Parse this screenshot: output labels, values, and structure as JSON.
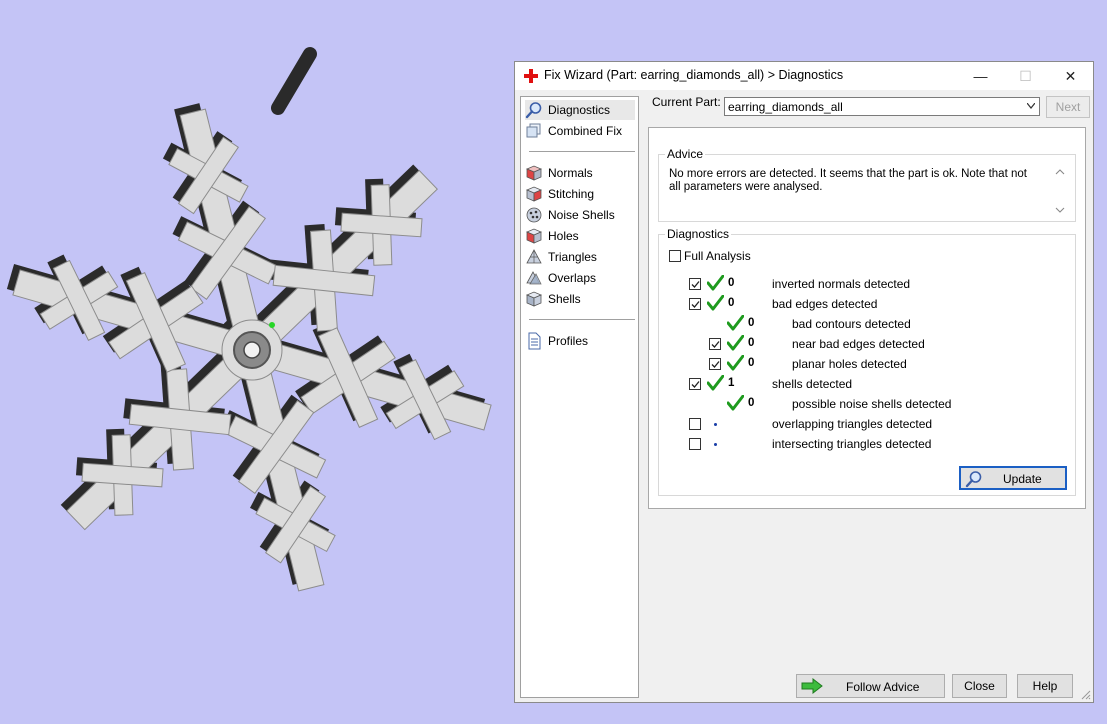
{
  "window": {
    "title": "Fix Wizard (Part: earring_diamonds_all) > Diagnostics",
    "controls": {
      "minimize": "—",
      "maximize": "☐",
      "close": "✕"
    }
  },
  "nav": {
    "items": [
      {
        "label": "Diagnostics",
        "icon": "magnifier-icon",
        "active": true
      },
      {
        "label": "Combined Fix",
        "icon": "combined-fix-icon"
      },
      {
        "label": "Normals",
        "icon": "normals-cube-icon"
      },
      {
        "label": "Stitching",
        "icon": "stitching-cube-icon"
      },
      {
        "label": "Noise Shells",
        "icon": "noise-shells-icon"
      },
      {
        "label": "Holes",
        "icon": "holes-cube-icon"
      },
      {
        "label": "Triangles",
        "icon": "triangles-icon"
      },
      {
        "label": "Overlaps",
        "icon": "overlaps-icon"
      },
      {
        "label": "Shells",
        "icon": "shells-icon"
      },
      {
        "label": "Profiles",
        "icon": "profiles-document-icon"
      }
    ]
  },
  "current_part": {
    "label": "Current Part:",
    "value": "earring_diamonds_all",
    "next_label": "Next"
  },
  "advice": {
    "title": "Advice",
    "text": "No more errors are detected. It seems that the part is ok. Note that not all parameters were analysed."
  },
  "diagnostics": {
    "title": "Diagnostics",
    "full_analysis_label": "Full Analysis",
    "full_analysis_checked": false,
    "rows": [
      {
        "checkbox": true,
        "checked": true,
        "status": "ok",
        "count": "0",
        "label": "inverted normals detected",
        "indent": 0
      },
      {
        "checkbox": true,
        "checked": true,
        "status": "ok",
        "count": "0",
        "label": "bad edges detected",
        "indent": 0
      },
      {
        "checkbox": false,
        "checked": false,
        "status": "ok",
        "count": "0",
        "label": "bad contours detected",
        "indent": 1
      },
      {
        "checkbox": true,
        "checked": true,
        "status": "ok",
        "count": "0",
        "label": "near bad edges detected",
        "indent": 1
      },
      {
        "checkbox": true,
        "checked": true,
        "status": "ok",
        "count": "0",
        "label": "planar holes detected",
        "indent": 1
      },
      {
        "checkbox": true,
        "checked": true,
        "status": "ok",
        "count": "1",
        "label": "shells detected",
        "indent": 0
      },
      {
        "checkbox": false,
        "checked": false,
        "status": "ok",
        "count": "0",
        "label": "possible noise shells detected",
        "indent": 1
      },
      {
        "checkbox": true,
        "checked": false,
        "status": "pending",
        "count": "",
        "label": "overlapping triangles detected",
        "indent": 0
      },
      {
        "checkbox": true,
        "checked": false,
        "status": "pending",
        "count": "",
        "label": "intersecting triangles detected",
        "indent": 0
      }
    ],
    "update_label": "Update"
  },
  "footer": {
    "follow_advice_label": "Follow Advice",
    "close_label": "Close",
    "help_label": "Help"
  },
  "colors": {
    "background": "#c4c4f6",
    "model_face": "#dcdcdc",
    "model_side": "#2b2b2b",
    "ok_check": "#1e9a1e",
    "app_icon": "#e01010",
    "accent_border": "#1b5fc4"
  }
}
